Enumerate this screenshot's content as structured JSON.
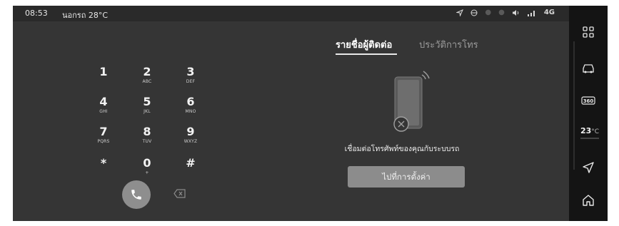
{
  "status_bar": {
    "time": "08:53",
    "weather": "นอกรถ 28°C",
    "network": "4G"
  },
  "keypad": [
    {
      "digit": "1",
      "letters": ""
    },
    {
      "digit": "2",
      "letters": "ABC"
    },
    {
      "digit": "3",
      "letters": "DEF"
    },
    {
      "digit": "4",
      "letters": "GHI"
    },
    {
      "digit": "5",
      "letters": "JKL"
    },
    {
      "digit": "6",
      "letters": "MNO"
    },
    {
      "digit": "7",
      "letters": "PQRS"
    },
    {
      "digit": "8",
      "letters": "TUV"
    },
    {
      "digit": "9",
      "letters": "WXYZ"
    },
    {
      "digit": "*",
      "letters": ""
    },
    {
      "digit": "0",
      "letters": "+"
    },
    {
      "digit": "#",
      "letters": ""
    }
  ],
  "tabs": {
    "contacts": "รายชื่อผู้ติดต่อ",
    "call_history": "ประวัติการโทร"
  },
  "message": "เชื่อมต่อโทรศัพท์ของคุณกับระบบรถ",
  "settings_button": "ไปที่การตั้งค่า",
  "side_rail": {
    "temperature": "23",
    "temp_unit": "°C"
  },
  "icons": {
    "rail": [
      "apps-grid-icon",
      "car-icon",
      "360-view-icon",
      "navigation-icon",
      "home-icon"
    ],
    "status": [
      "location-arrow-icon",
      "globe-icon",
      "volume-icon",
      "signal-bars-icon"
    ]
  },
  "colors": {
    "screen_bg": "#353535",
    "rail_bg": "#141414",
    "button_bg": "#8c8c8c",
    "call_button_bg": "#8e8e8e"
  }
}
